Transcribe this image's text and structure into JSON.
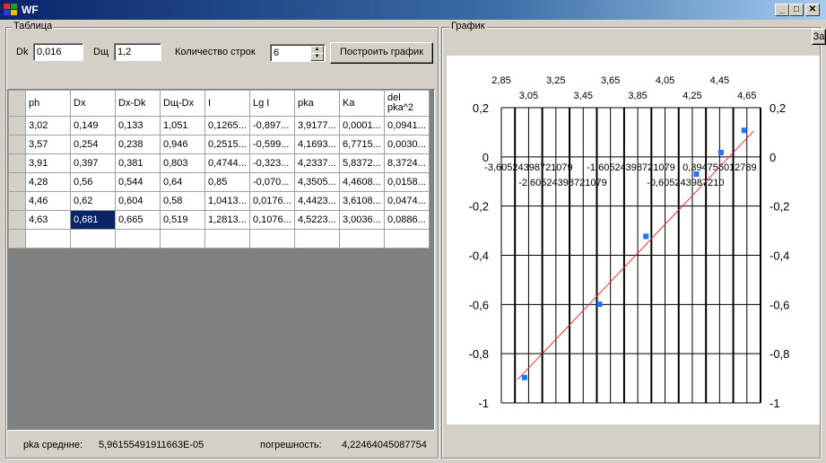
{
  "window": {
    "title": "WF",
    "minimize": "_",
    "maximize": "□",
    "close": "✕"
  },
  "table_group": {
    "label": "Таблица",
    "dk_label": "Dk",
    "dk_value": "0,016",
    "dsh_label": "Dщ",
    "dsh_value": "1,2",
    "rows_label": "Количество строк",
    "rows_value": "6",
    "build_button": "Построить график"
  },
  "grid": {
    "headers": [
      "ph",
      "Dx",
      "Dx-Dk",
      "Dщ-Dx",
      "I",
      "Lg I",
      "pka",
      "Ka",
      "del pka^2"
    ],
    "rows": [
      [
        "3,02",
        "0,149",
        "0,133",
        "1,051",
        "0,1265...",
        "-0,897...",
        "3,9177...",
        "0,0001...",
        "0,0941..."
      ],
      [
        "3,57",
        "0,254",
        "0,238",
        "0,946",
        "0,2515...",
        "-0,599...",
        "4,1693...",
        "6,7715...",
        "0,0030..."
      ],
      [
        "3,91",
        "0,397",
        "0,381",
        "0,803",
        "0,4744...",
        "-0,323...",
        "4,2337...",
        "5,8372...",
        "8,3724..."
      ],
      [
        "4,28",
        "0,56",
        "0,544",
        "0,64",
        "0,85",
        "-0,070...",
        "4,3505...",
        "4,4608...",
        "0,0158..."
      ],
      [
        "4,46",
        "0,62",
        "0,604",
        "0,58",
        "1,0413...",
        "0,0176...",
        "4,4423...",
        "3,6108...",
        "0,0474..."
      ],
      [
        "4,63",
        "0,681",
        "0,665",
        "0,519",
        "1,2813...",
        "0,1076...",
        "4,5223...",
        "3,0036...",
        "0,0886..."
      ]
    ]
  },
  "status": {
    "pka_label": "pka среднне:",
    "pka_value": "5,96155491911663E-05",
    "error_label": "погрешность:",
    "error_value": "4,22464045087754"
  },
  "chart_group": {
    "label": "График",
    "side_button": "За"
  },
  "chart_data": {
    "type": "scatter",
    "x_top_ticks_row1": [
      "2,85",
      "3,25",
      "3,65",
      "4,05",
      "4,45"
    ],
    "x_top_ticks_row2": [
      "3,05",
      "3,45",
      "3,85",
      "4,25",
      "4,65"
    ],
    "y_ticks": [
      "0,2",
      "0",
      "-0,2",
      "-0,4",
      "-0,6",
      "-0,8",
      "-1"
    ],
    "ylim": [
      -1,
      0.2
    ],
    "xlim": [
      2.85,
      4.75
    ],
    "inner_labels": [
      "-3,60524398721079",
      "-1,60524398721079",
      "0,394756012789",
      "-2,60524398721079",
      "-0,605243987210"
    ],
    "points": [
      {
        "x": 3.02,
        "y": -0.897
      },
      {
        "x": 3.57,
        "y": -0.599
      },
      {
        "x": 3.91,
        "y": -0.323
      },
      {
        "x": 4.28,
        "y": -0.07
      },
      {
        "x": 4.46,
        "y": 0.0176
      },
      {
        "x": 4.63,
        "y": 0.1076
      }
    ],
    "fit_line": [
      {
        "x": 2.97,
        "y": -0.905
      },
      {
        "x": 4.7,
        "y": 0.105
      }
    ],
    "point_color": "#1e78ff",
    "line_color": "#e03030"
  }
}
